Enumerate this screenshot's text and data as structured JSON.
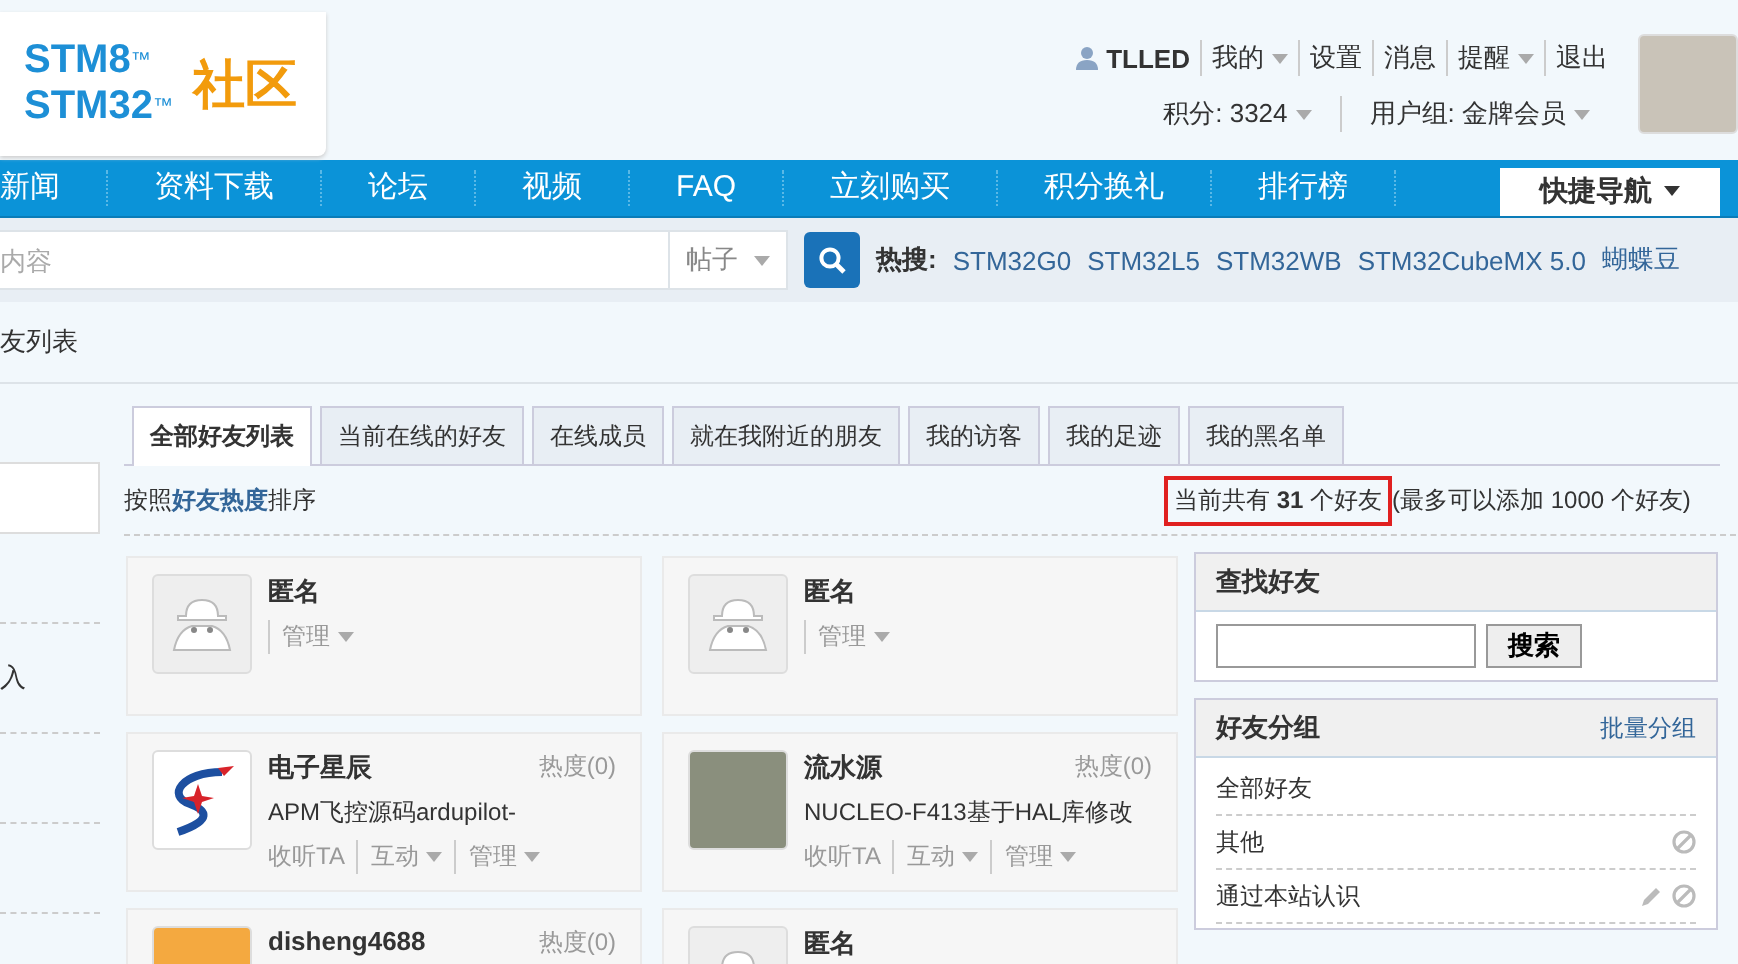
{
  "logo": {
    "lines": [
      {
        "text": "STM8",
        "mark": "™"
      },
      {
        "text": "STM32",
        "mark": "™"
      }
    ],
    "title": "社区"
  },
  "user_menu": {
    "items": [
      {
        "label": "TLLED",
        "kind": "user",
        "dropdown": false
      },
      {
        "label": "我的",
        "kind": "link",
        "dropdown": true
      },
      {
        "label": "设置",
        "kind": "link",
        "dropdown": false
      },
      {
        "label": "消息",
        "kind": "link",
        "dropdown": false
      },
      {
        "label": "提醒",
        "kind": "link",
        "dropdown": true
      },
      {
        "label": "退出",
        "kind": "link",
        "dropdown": false
      }
    ],
    "stats": [
      {
        "label": "积分: 3324",
        "dropdown": true
      },
      {
        "label": "用户组: 金牌会员",
        "dropdown": true
      }
    ]
  },
  "nav": {
    "items": [
      "新闻",
      "资料下载",
      "论坛",
      "视频",
      "FAQ",
      "立刻购买",
      "积分换礼",
      "排行榜"
    ],
    "quick_nav": "快捷导航"
  },
  "search": {
    "placeholder": "内容",
    "type": "帖子",
    "hot_label": "热搜:",
    "hot": [
      "STM32G0",
      "STM32L5",
      "STM32WB",
      "STM32CubeMX 5.0",
      "蝴蝶豆"
    ]
  },
  "breadcrumb": "友列表",
  "left_panel": {
    "items": [
      "入"
    ]
  },
  "tabs": [
    {
      "label": "全部好友列表",
      "selected": true
    },
    {
      "label": "当前在线的好友",
      "selected": false
    },
    {
      "label": "在线成员",
      "selected": false
    },
    {
      "label": "就在我附近的朋友",
      "selected": false
    },
    {
      "label": "我的访客",
      "selected": false
    },
    {
      "label": "我的足迹",
      "selected": false
    },
    {
      "label": "我的黑名单",
      "selected": false
    }
  ],
  "sort_text": "按照**好友热度**排序",
  "count": {
    "text": "当前共有 **31** 个好友",
    "highlighted": true,
    "limit": "(最多可以添加 1000 个好友)"
  },
  "friends": [
    {
      "name": "匿名",
      "kind": "anonymous",
      "actions": [
        {
          "label": "管理",
          "dropdown": true
        }
      ]
    },
    {
      "name": "匿名",
      "kind": "anonymous",
      "actions": [
        {
          "label": "管理",
          "dropdown": true
        }
      ]
    },
    {
      "name": "电子星辰",
      "heat": "热度(0)",
      "note": "APM飞控源码ardupilot-",
      "kind": "logo",
      "actions": [
        {
          "label": "收听TA",
          "dropdown": false
        },
        {
          "label": "互动",
          "dropdown": true
        },
        {
          "label": "管理",
          "dropdown": true
        }
      ]
    },
    {
      "name": "流水源",
      "heat": "热度(0)",
      "note": "NUCLEO-F413基于HAL库修改",
      "kind": "photo",
      "actions": [
        {
          "label": "收听TA",
          "dropdown": false
        },
        {
          "label": "互动",
          "dropdown": true
        },
        {
          "label": "管理",
          "dropdown": true
        }
      ]
    },
    {
      "name": "disheng4688",
      "heat": "热度(0)",
      "kind": "orange"
    },
    {
      "name": "匿名",
      "kind": "anonymous"
    }
  ],
  "find_friend": {
    "title": "查找好友",
    "button": "搜索"
  },
  "groups": {
    "title": "好友分组",
    "action": "批量分组",
    "items": [
      {
        "label": "全部好友",
        "editable": false,
        "deletable": false
      },
      {
        "label": "其他",
        "editable": false,
        "deletable": true
      },
      {
        "label": "通过本站认识",
        "editable": true,
        "deletable": true
      }
    ]
  }
}
